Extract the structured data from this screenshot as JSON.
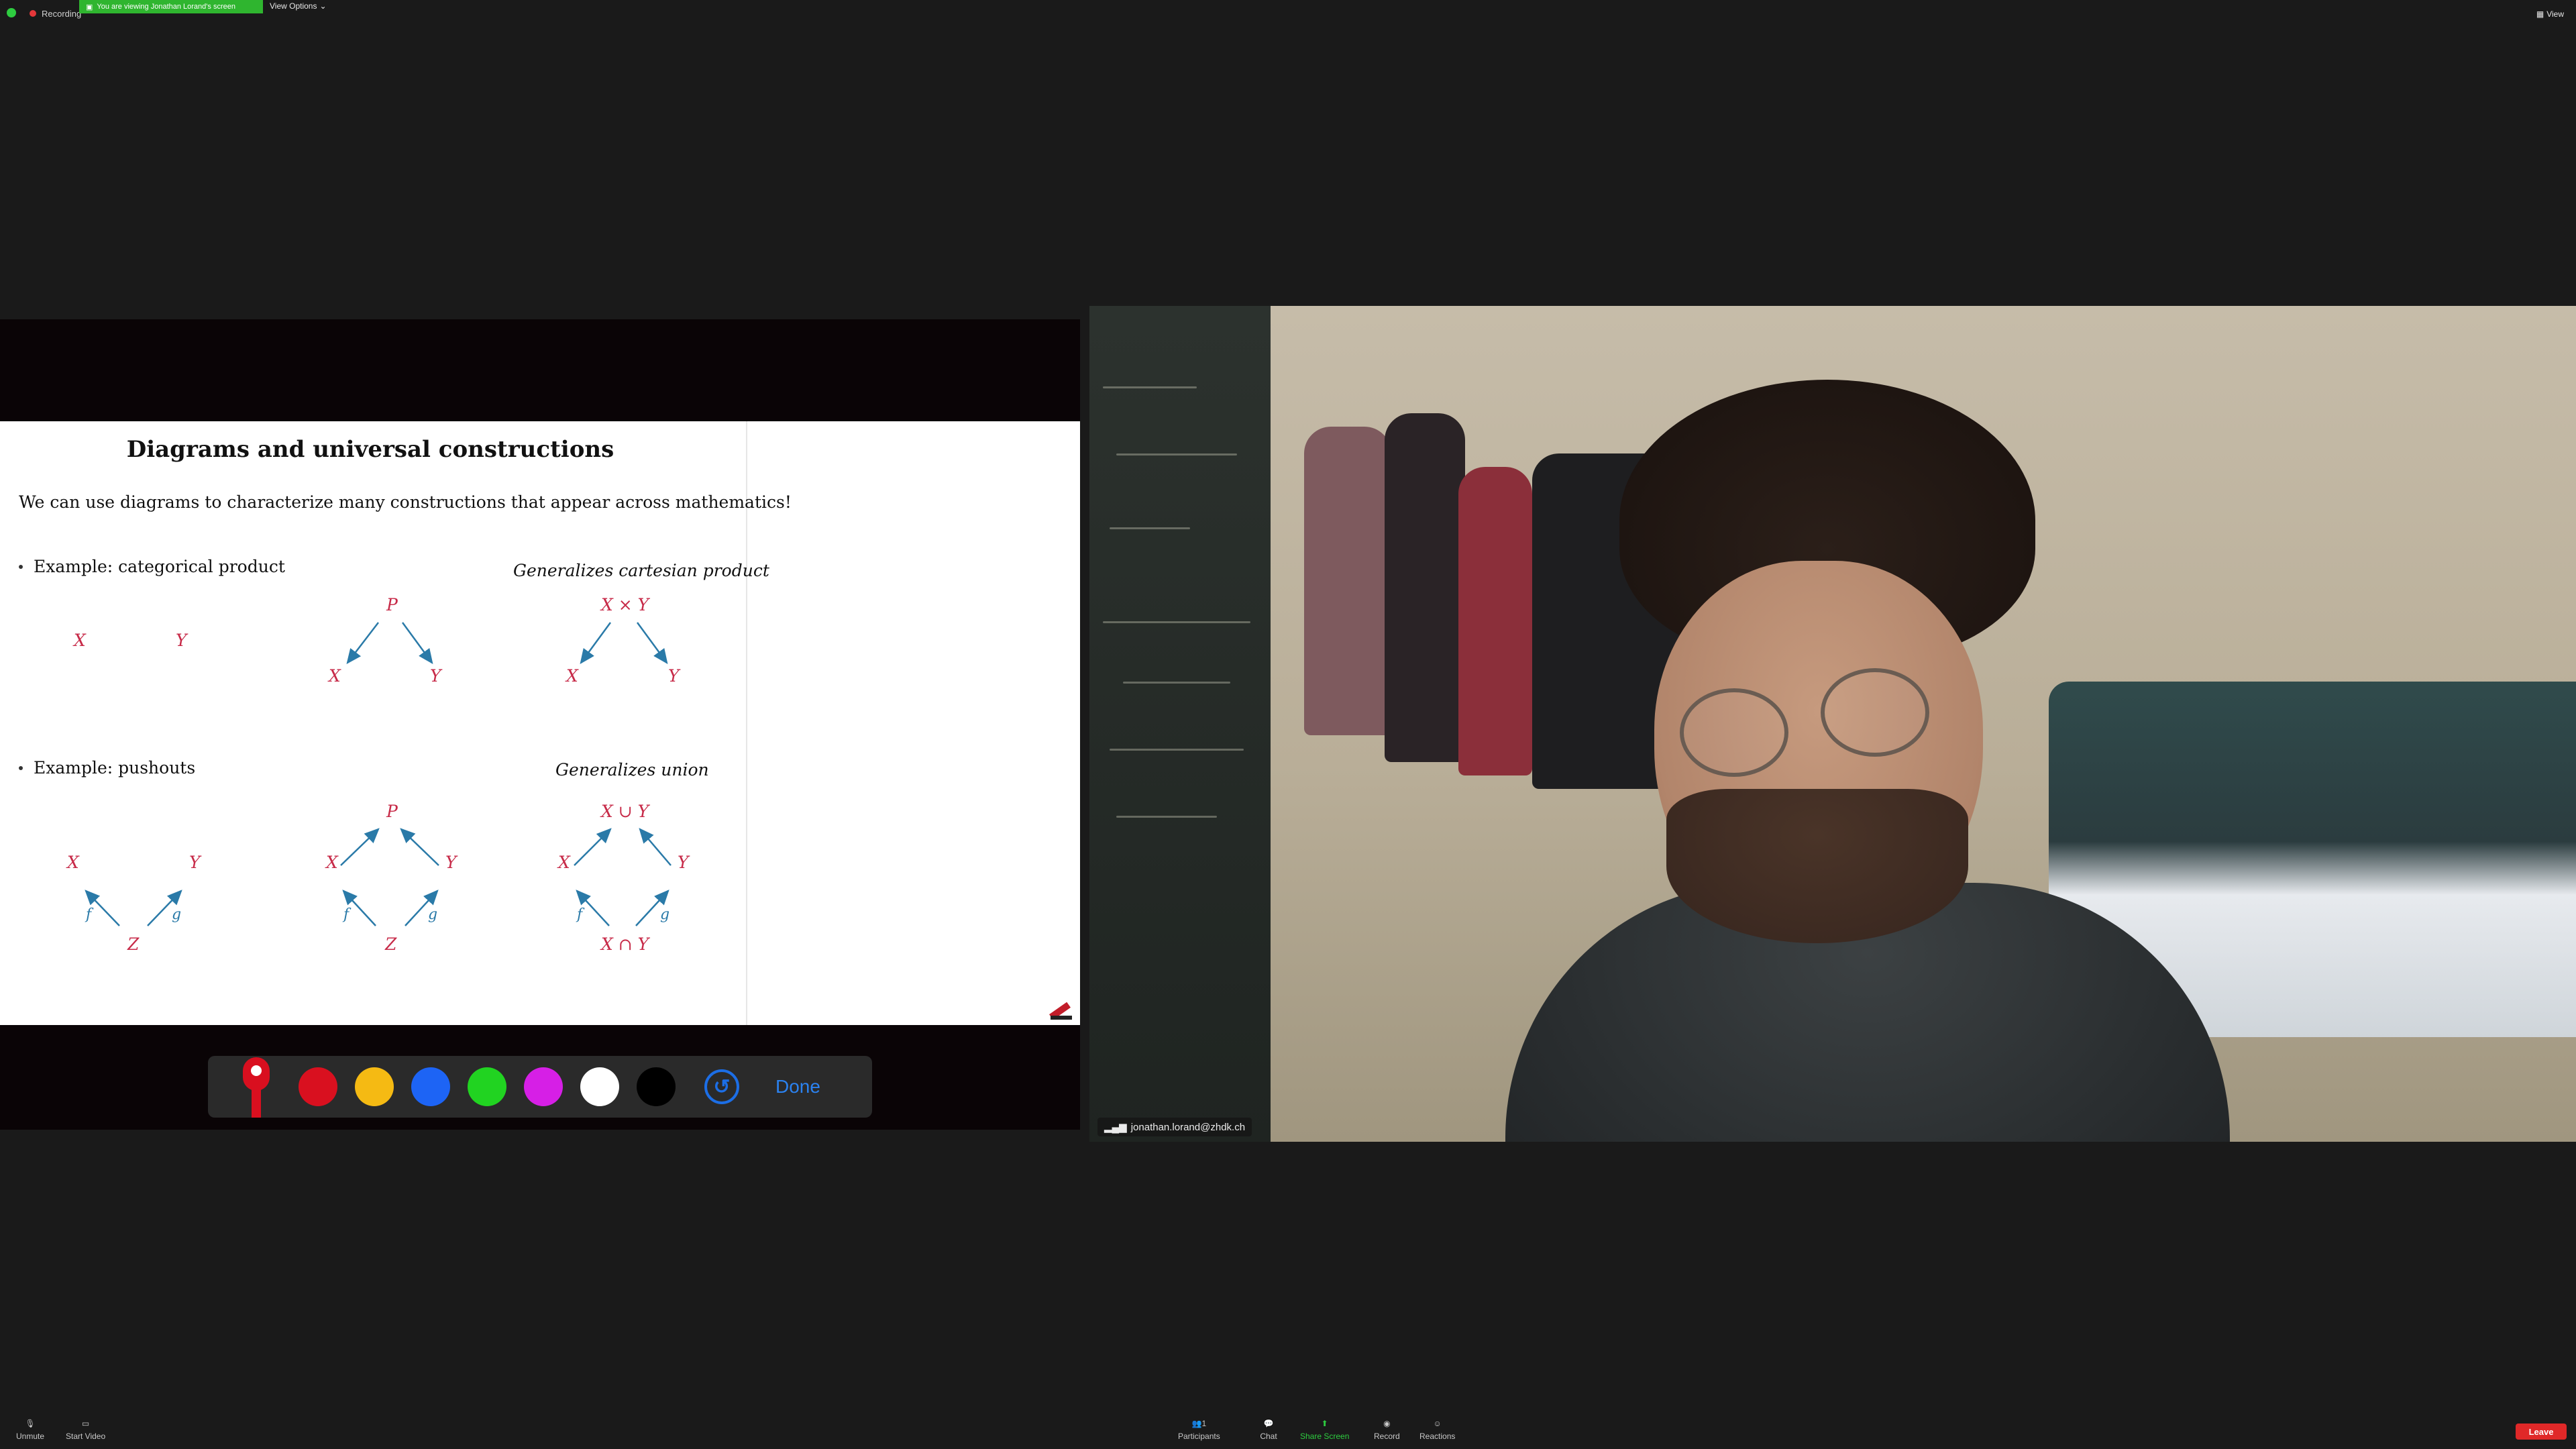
{
  "top_bar": {
    "recording_label": "Recording",
    "viewing_banner": "You are viewing Jonathan Lorand's screen",
    "view_options": "View Options",
    "view_label": "View"
  },
  "slide": {
    "title": "Diagrams and universal constructions",
    "intro": "We can use diagrams to characterize many constructions that appear across mathematics!",
    "example1": "Example: categorical product",
    "generalizes1": "Generalizes cartesian product",
    "example2": "Example: pushouts",
    "generalizes2": "Generalizes union",
    "symbols": {
      "X": "X",
      "Y": "Y",
      "P": "P",
      "Z": "Z",
      "f": "f",
      "g": "g",
      "XxY": "X × Y",
      "XuY": "X ∪ Y",
      "XnY": "X ∩ Y"
    }
  },
  "annotation": {
    "colors": [
      "#d9101f",
      "#f5ba13",
      "#1d64f5",
      "#21d321",
      "#d61fe6",
      "#ffffff",
      "#000000"
    ],
    "done_label": "Done",
    "undo_icon": "undo-icon"
  },
  "video": {
    "participant_name": "jonathan.lorand@zhdk.ch"
  },
  "bottom_toolbar": {
    "unmute": "Unmute",
    "start_video": "Start Video",
    "participants": "Participants",
    "participants_count": "1",
    "chat": "Chat",
    "share_screen": "Share Screen",
    "record": "Record",
    "reactions": "Reactions",
    "leave": "Leave"
  }
}
